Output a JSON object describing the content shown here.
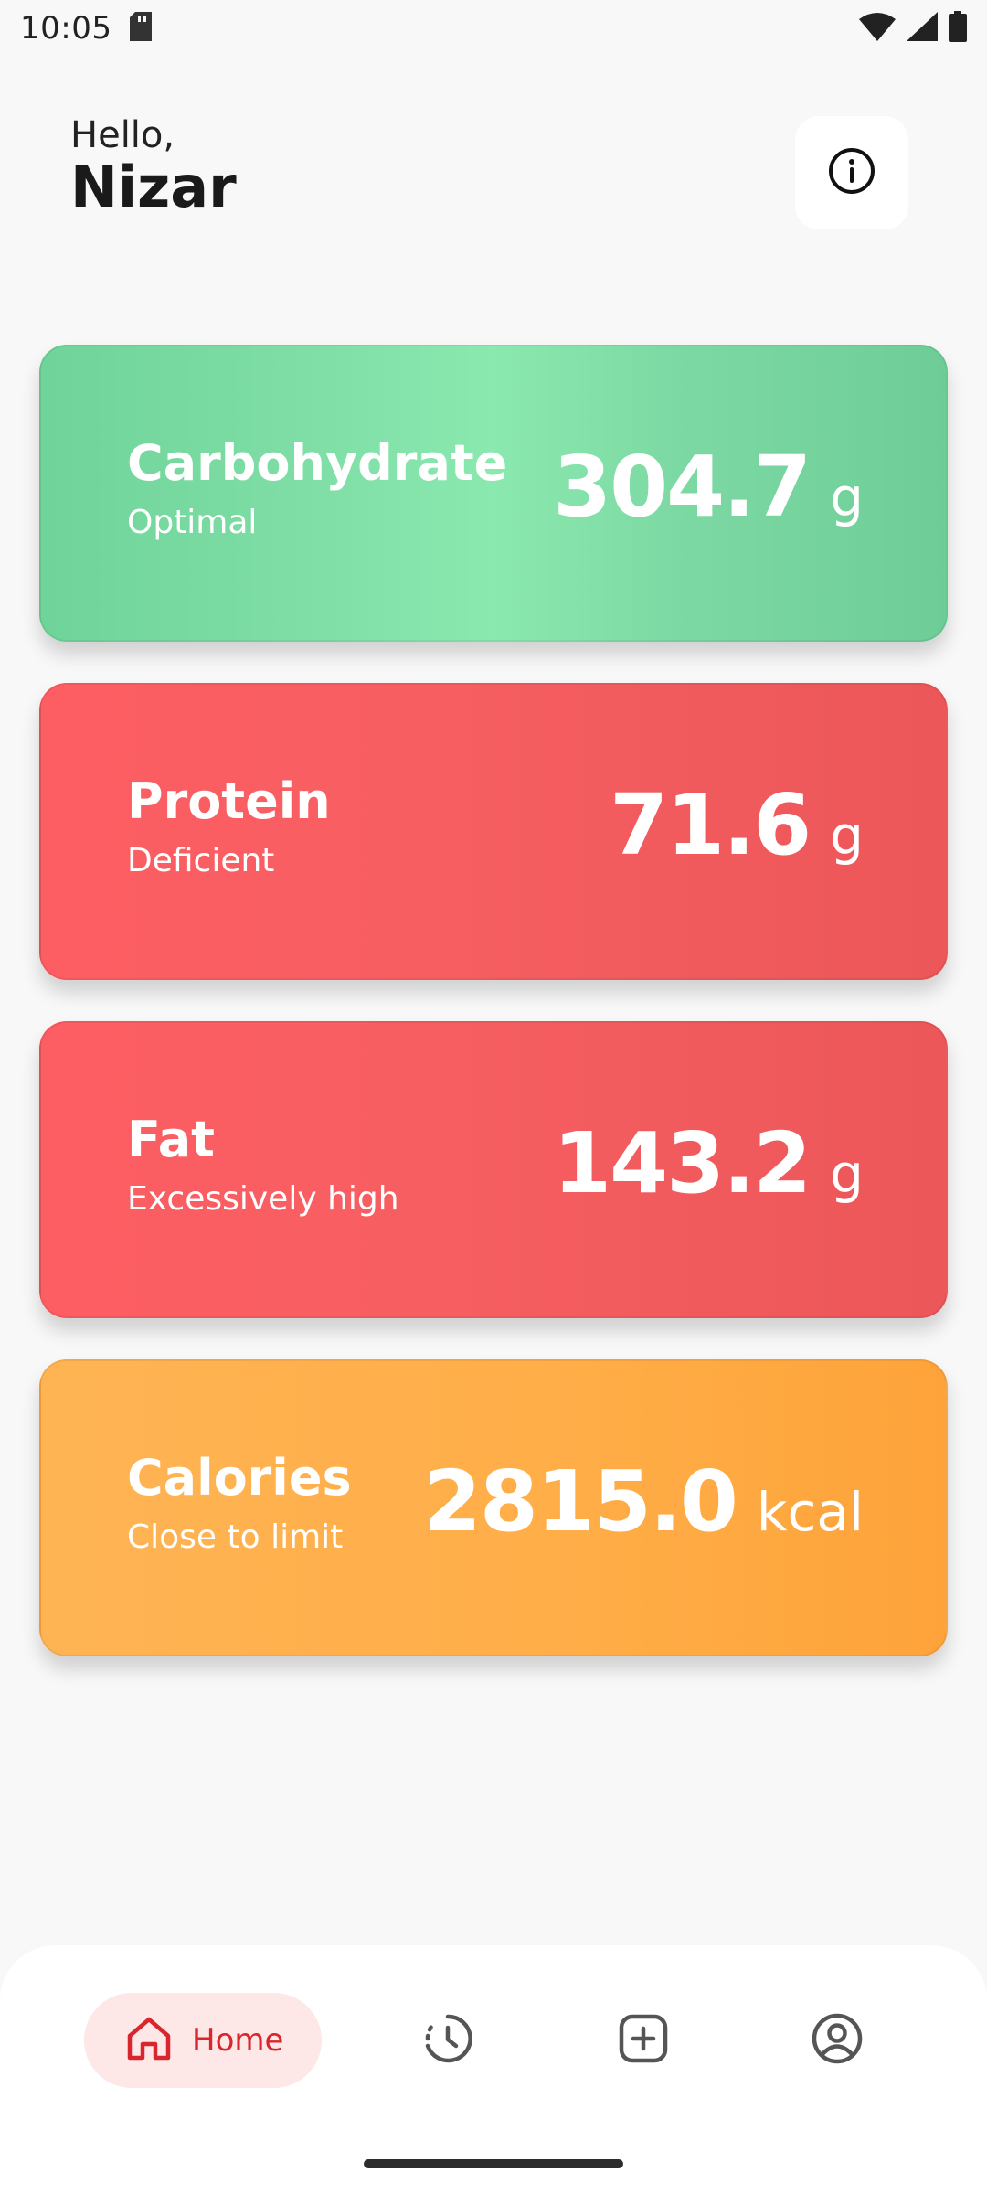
{
  "status_bar": {
    "time": "10:05"
  },
  "header": {
    "greeting": "Hello,",
    "name": "Nizar"
  },
  "nutrients": [
    {
      "title": "Carbohydrate",
      "status": "Optimal",
      "value": "304.7",
      "unit": "g",
      "color": "#7fdea6"
    },
    {
      "title": "Protein",
      "status": "Deficient",
      "value": "71.6",
      "unit": "g",
      "color": "#f65e61"
    },
    {
      "title": "Fat",
      "status": "Excessively high",
      "value": "143.2",
      "unit": "g",
      "color": "#f65e61"
    },
    {
      "title": "Calories",
      "status": "Close to limit",
      "value": "2815.0",
      "unit": "kcal",
      "color": "#ffad47"
    }
  ],
  "nav": {
    "home_label": "Home",
    "items": [
      "home-icon",
      "history-icon",
      "add-icon",
      "profile-icon"
    ],
    "accent": "#d8262c"
  },
  "icons": {
    "info": "info-icon",
    "sd_card": "sd-card-icon",
    "wifi": "wifi-icon",
    "signal": "signal-icon",
    "battery": "battery-icon"
  }
}
